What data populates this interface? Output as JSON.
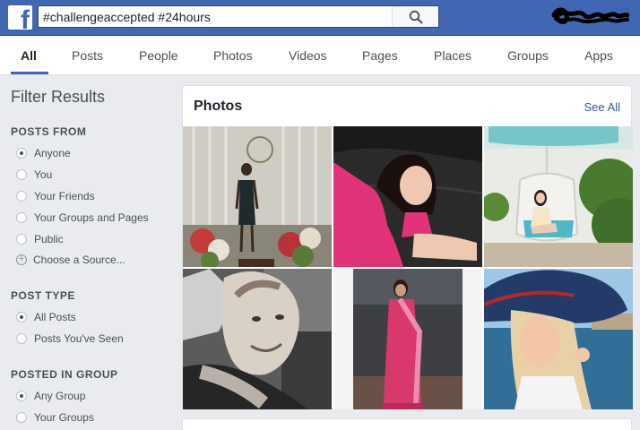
{
  "header": {
    "logo_letter": "f",
    "search_value": "#challengeaccepted #24hours",
    "search_icon": "search-icon"
  },
  "tabs": [
    {
      "label": "All",
      "active": true
    },
    {
      "label": "Posts"
    },
    {
      "label": "People"
    },
    {
      "label": "Photos"
    },
    {
      "label": "Videos"
    },
    {
      "label": "Pages"
    },
    {
      "label": "Places"
    },
    {
      "label": "Groups"
    },
    {
      "label": "Apps"
    }
  ],
  "sidebar": {
    "title": "Filter Results",
    "posts_from": {
      "title": "POSTS FROM",
      "options": [
        "Anyone",
        "You",
        "Your Friends",
        "Your Groups and Pages",
        "Public"
      ],
      "selected": "Anyone",
      "choose_source": "Choose a Source..."
    },
    "post_type": {
      "title": "POST TYPE",
      "options": [
        "All Posts",
        "Posts You've Seen"
      ],
      "selected": "All Posts"
    },
    "posted_in_group": {
      "title": "POSTED IN GROUP",
      "options": [
        "Any Group",
        "Your Groups"
      ],
      "selected": "Any Group"
    }
  },
  "photos": {
    "title": "Photos",
    "see_all": "See All"
  },
  "colors": {
    "brand_blue": "#4267b2",
    "link_blue": "#365899",
    "page_bg": "#e9ebee"
  }
}
